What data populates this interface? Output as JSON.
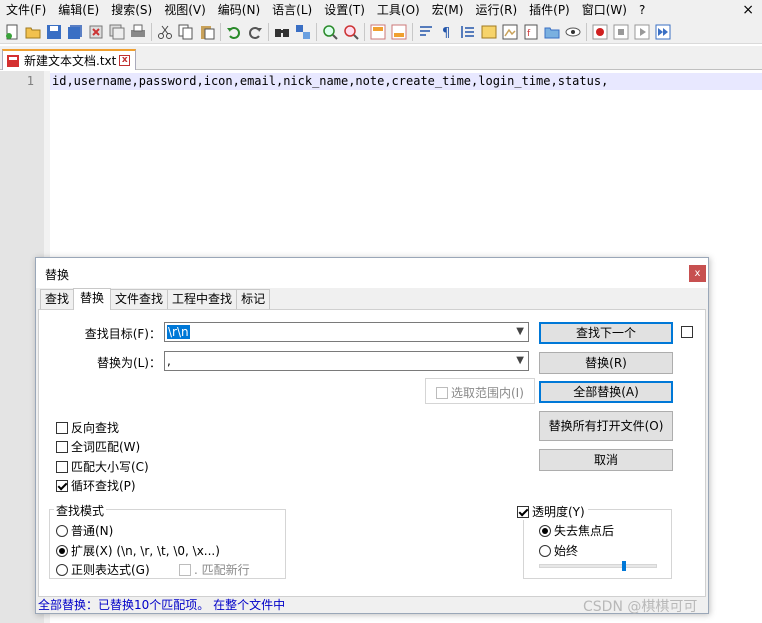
{
  "menubar": {
    "items": [
      "文件(F)",
      "编辑(E)",
      "搜索(S)",
      "视图(V)",
      "编码(N)",
      "语言(L)",
      "设置(T)",
      "工具(O)",
      "宏(M)",
      "运行(R)",
      "插件(P)",
      "窗口(W)",
      "?"
    ],
    "close_glyph": "×"
  },
  "toolbar": {
    "icons": [
      "new-file-icon",
      "open-file-icon",
      "save-icon",
      "save-all-icon",
      "close-icon",
      "close-all-icon",
      "print-icon",
      "cut-icon",
      "copy-icon",
      "paste-icon",
      "undo-icon",
      "redo-icon",
      "find-icon",
      "replace-icon",
      "zoom-in-icon",
      "zoom-out-icon",
      "sync-vertical-icon",
      "sync-horizontal-icon",
      "word-wrap-icon",
      "show-all-chars-icon",
      "indent-guide-icon",
      "user-lang-icon",
      "doc-map-icon",
      "function-list-icon",
      "folder-workspace-icon",
      "monitoring-icon",
      "record-macro-icon",
      "stop-record-icon",
      "play-macro-icon",
      "run-macro-multiple-icon"
    ]
  },
  "tabbar": {
    "tab_label": "新建文本文档.txt",
    "close_glyph": "x"
  },
  "editor": {
    "line_number": "1",
    "line_text": "id,username,password,icon,email,nick_name,note,create_time,login_time,status,"
  },
  "dialog": {
    "title": "替换",
    "close_glyph": "x",
    "tabs": [
      "查找",
      "替换",
      "文件查找",
      "工程中查找",
      "标记"
    ],
    "find_label": "查找目标(F)：",
    "find_value": "\\r\\n",
    "replace_label": "替换为(L)：",
    "replace_value": ",",
    "in_selection_label": "选取范围内(I)",
    "buttons": {
      "find_next": "查找下一个",
      "replace": "替换(R)",
      "replace_all": "全部替换(A)",
      "replace_all_open": "替换所有打开文件(O)",
      "cancel": "取消"
    },
    "options": {
      "backward": "反向查找",
      "whole_word": "全词匹配(W)",
      "match_case": "匹配大小写(C)",
      "wrap_around": "循环查找(P)"
    },
    "search_mode": {
      "title": "查找模式",
      "normal": "普通(N)",
      "extended": "扩展(X) (\\n, \\r, \\t, \\0, \\x...)",
      "regex": "正则表达式(G)",
      "dot_matches_newline": ". 匹配新行"
    },
    "transparency": {
      "label": "透明度(Y)",
      "on_lose_focus": "失去焦点后",
      "always": "始终",
      "level": 0.72
    },
    "status": "全部替换：已替换10个匹配项。 在整个文件中"
  },
  "watermark": "CSDN @棋棋可可",
  "colors": {
    "selection": "#0078d7",
    "current_line": "#e8e8ff",
    "status_text": "#0000c8",
    "close_red": "#c75050"
  }
}
